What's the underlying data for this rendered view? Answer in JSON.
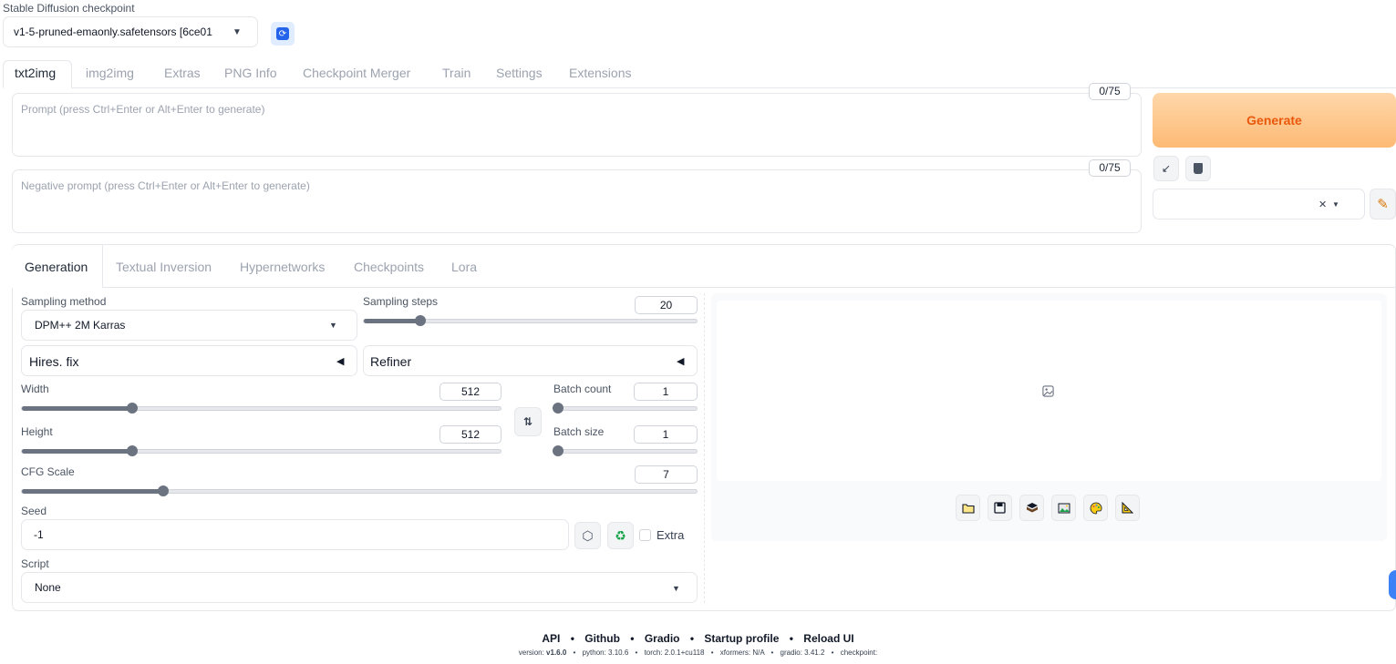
{
  "checkpoint": {
    "label": "Stable Diffusion checkpoint",
    "value": "v1-5-pruned-emaonly.safetensors [6ce01",
    "refresh_icon": "refresh-icon"
  },
  "tabs": [
    "txt2img",
    "img2img",
    "Extras",
    "PNG Info",
    "Checkpoint Merger",
    "Train",
    "Settings",
    "Extensions"
  ],
  "prompt": {
    "placeholder": "Prompt (press Ctrl+Enter or Alt+Enter to generate)",
    "token_count": "0/75"
  },
  "negative_prompt": {
    "placeholder": "Negative prompt (press Ctrl+Enter or Alt+Enter to generate)",
    "token_count": "0/75"
  },
  "generate": {
    "label": "Generate",
    "color": "#fb923c"
  },
  "subtabs": [
    "Generation",
    "Textual Inversion",
    "Hypernetworks",
    "Checkpoints",
    "Lora"
  ],
  "sampling": {
    "method_label": "Sampling method",
    "method_value": "DPM++ 2M Karras",
    "steps_label": "Sampling steps",
    "steps_value": "20",
    "steps_level": 0.17
  },
  "accordions": {
    "hires": "Hires. fix",
    "refiner": "Refiner"
  },
  "width": {
    "label": "Width",
    "value": "512",
    "level": 0.23
  },
  "height": {
    "label": "Height",
    "value": "512",
    "level": 0.23
  },
  "batch_count": {
    "label": "Batch count",
    "value": "1",
    "level": 0.0
  },
  "batch_size": {
    "label": "Batch size",
    "value": "1",
    "level": 0.0
  },
  "cfg": {
    "label": "CFG Scale",
    "value": "7",
    "level": 0.21
  },
  "seed": {
    "label": "Seed",
    "value": "-1",
    "extra_label": "Extra"
  },
  "script": {
    "label": "Script",
    "value": "None"
  },
  "footer": {
    "links": [
      "API",
      "Github",
      "Gradio",
      "Startup profile",
      "Reload UI"
    ],
    "sep": "•",
    "version_label": "version:",
    "version": "v1.6.0",
    "python": "python: 3.10.6",
    "torch": "torch: 2.0.1+cu118",
    "xformers": "xformers: N/A",
    "gradio": "gradio: 3.41.2",
    "checkpoint": "checkpoint:"
  }
}
